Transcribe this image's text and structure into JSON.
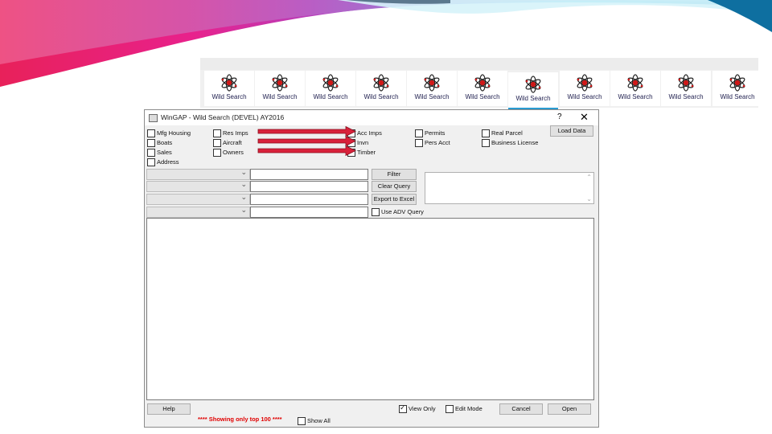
{
  "tabs": [
    {
      "label": "Wild Search",
      "icon": "atom-icon",
      "active": false
    },
    {
      "label": "Wild Search",
      "icon": "atom-icon",
      "active": false
    },
    {
      "label": "Wild Search",
      "icon": "atom-icon",
      "active": false
    },
    {
      "label": "Wild Search",
      "icon": "atom-icon",
      "active": false
    },
    {
      "label": "Wild Search",
      "icon": "atom-icon",
      "active": false
    },
    {
      "label": "Wild Search",
      "icon": "atom-icon",
      "active": false
    },
    {
      "label": "Wild Search",
      "icon": "atom-icon",
      "active": true
    },
    {
      "label": "Wild Search",
      "icon": "atom-icon",
      "active": false
    },
    {
      "label": "Wild Search",
      "icon": "atom-icon",
      "active": false
    },
    {
      "label": "Wild Search",
      "icon": "atom-icon",
      "active": false
    },
    {
      "label": "Wild Search",
      "icon": "atom-icon",
      "active": false
    }
  ],
  "dialog": {
    "title": "WinGAP - Wild Search (DEVEL) AY2016",
    "help_label": "?",
    "close_label": "✕",
    "checkboxes": {
      "mfg_housing": "Mfg Housing",
      "boats": "Boats",
      "sales": "Sales",
      "address": "Address",
      "res_imps": "Res Imps",
      "aircraft": "Aircraft",
      "owners": "Owners",
      "acc_imps": "Acc Imps",
      "invn": "Invn",
      "timber": "Timber",
      "permits": "Permits",
      "pers_acct": "Pers Acct",
      "real_parcel": "Real Parcel",
      "business_license": "Business License"
    },
    "buttons": {
      "load_data": "Load Data",
      "filter": "Filter",
      "clear_query": "Clear Query",
      "export_to_excel": "Export to Excel",
      "help": "Help",
      "cancel": "Cancel",
      "open": "Open"
    },
    "use_adv_query": "Use ADV Query",
    "view_only": {
      "label": "View Only",
      "checked": true
    },
    "edit_mode": {
      "label": "Edit Mode",
      "checked": false
    },
    "show_all": {
      "label": "Show All",
      "checked": false
    },
    "status_text": "**** Showing only top 100 ****"
  },
  "colors": {
    "accent_underline": "#2a9bd1",
    "arrow_red": "#d8213a",
    "status_red": "#e00000",
    "swoosh_magenta": "#e8218c",
    "swoosh_cyan": "#2ec4e8"
  }
}
